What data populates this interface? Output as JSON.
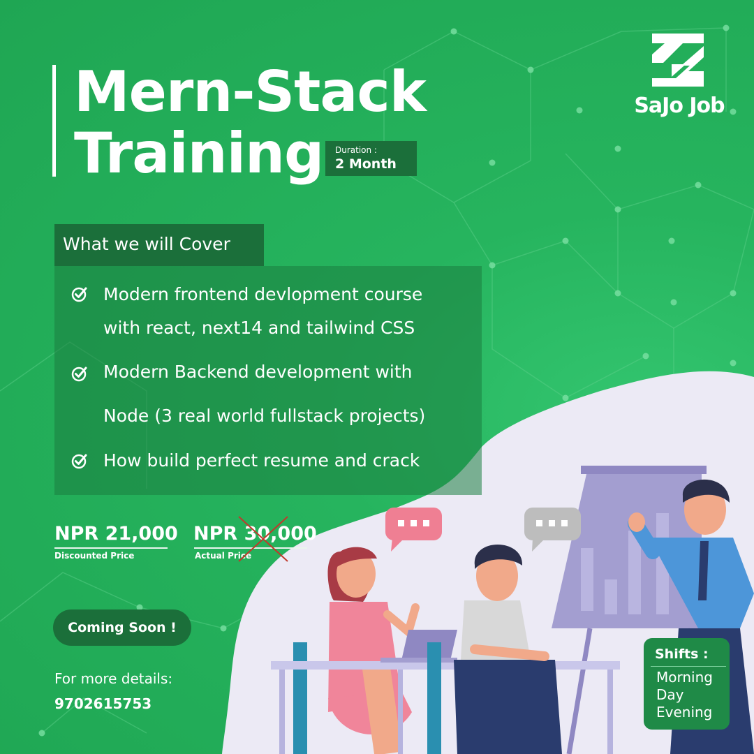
{
  "title": {
    "line1": "Mern-Stack",
    "line2": "Training"
  },
  "duration": {
    "label": "Duration :",
    "value": "2  Month"
  },
  "logo": {
    "text": "SaJo Job"
  },
  "cover": {
    "heading": "What we will Cover",
    "items": [
      "Modern frontend devlopment course",
      "with react, next14 and tailwind CSS",
      "Modern Backend development with",
      "Node (3 real world fullstack projects)",
      "How build perfect resume and crack"
    ]
  },
  "pricing": {
    "discounted_price": "NPR 21,000",
    "discounted_label": "Discounted Price",
    "actual_price": "NPR 30,000",
    "actual_label": "Actual Price"
  },
  "cta": {
    "coming_soon": "Coming Soon !"
  },
  "contact": {
    "label": "For more details:",
    "phone": "9702615753"
  },
  "shifts": {
    "title": "Shifts :",
    "items": [
      "Morning",
      "Day",
      "Evening"
    ]
  },
  "colors": {
    "brand_green": "#26b45e",
    "dark_green": "#1b6f3a",
    "accent_red": "#c0392b"
  },
  "icons": {
    "check": "check-circle-icon",
    "speech": "speech-bubble-icon"
  }
}
